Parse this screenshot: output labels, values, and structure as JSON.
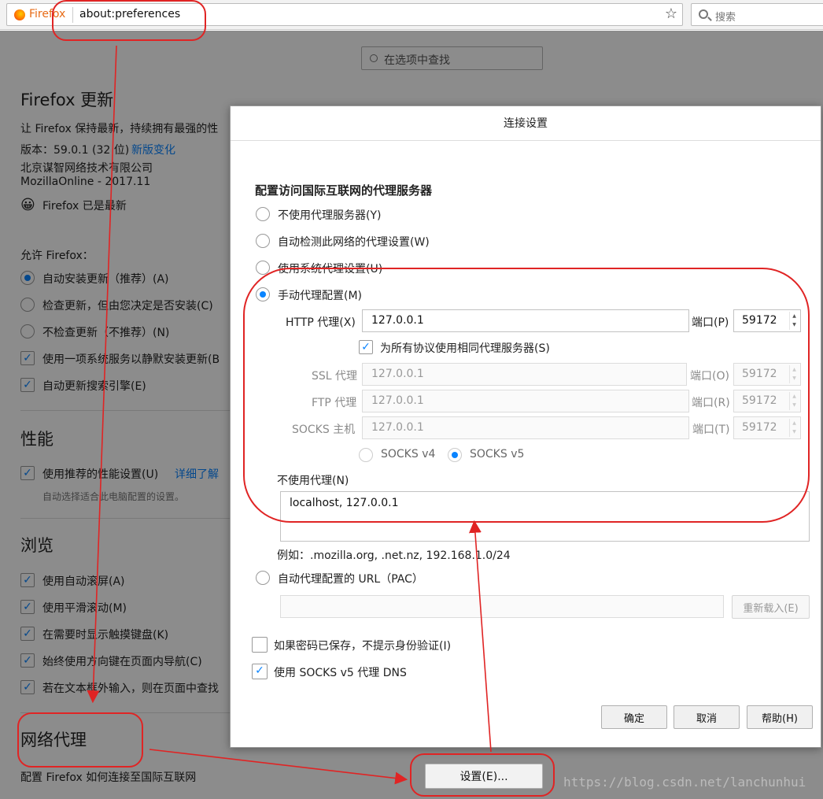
{
  "browser": {
    "brand": "Firefox",
    "url": "about:preferences",
    "search_placeholder": "搜索"
  },
  "prefs": {
    "search_placeholder": "在选项中查找",
    "update": {
      "title": "Firefox 更新",
      "desc": "让 Firefox 保持最新，持续拥有最强的性",
      "version": "版本：59.0.1 (32 位)",
      "changes_link": "新版变化",
      "company": "北京谋智网络技术有限公司",
      "build": "MozillaOnline - 2017.11",
      "status": "Firefox 已是最新",
      "allow_label": "允许 Firefox：",
      "opt_auto": "自动安装更新（推荐）(A)",
      "opt_check": "检查更新，但由您决定是否安装(C)",
      "opt_never": "不检查更新（不推荐）(N)",
      "opt_service": "使用一项系统服务以静默安装更新(B",
      "opt_engines": "自动更新搜索引擎(E)"
    },
    "perf": {
      "title": "性能",
      "recommended": "使用推荐的性能设置(U)",
      "learn_more": "详细了解",
      "hint": "自动选择适合此电脑配置的设置。"
    },
    "browsing": {
      "title": "浏览",
      "autoscroll": "使用自动滚屏(A)",
      "smooth": "使用平滑滚动(M)",
      "touch_kb": "在需要时显示触摸键盘(K)",
      "cursor_keys": "始终使用方向键在页面内导航(C)",
      "find_typing": "若在文本框外输入，则在页面中查找"
    },
    "network": {
      "title": "网络代理",
      "desc": "配置 Firefox 如何连接至国际互联网",
      "settings_button": "设置(E)..."
    }
  },
  "dialog": {
    "title": "连接设置",
    "heading": "配置访问国际互联网的代理服务器",
    "no_proxy": "不使用代理服务器(Y)",
    "auto_detect": "自动检测此网络的代理设置(W)",
    "system_proxy": "使用系统代理设置(U)",
    "manual": "手动代理配置(M)",
    "http_label": "HTTP 代理(X)",
    "http_value": "127.0.0.1",
    "port_p": "端口(P)",
    "http_port": "59172",
    "same_proxy": "为所有协议使用相同代理服务器(S)",
    "ssl_label": "SSL 代理",
    "ssl_value": "127.0.0.1",
    "port_o": "端口(O)",
    "ssl_port": "59172",
    "ftp_label": "FTP 代理",
    "ftp_value": "127.0.0.1",
    "port_r": "端口(R)",
    "ftp_port": "59172",
    "socks_label": "SOCKS 主机",
    "socks_value": "127.0.0.1",
    "port_t": "端口(T)",
    "socks_port": "59172",
    "socks4": "SOCKS v4",
    "socks5": "SOCKS v5",
    "no_proxy_for": "不使用代理(N)",
    "no_proxy_value": "localhost, 127.0.0.1",
    "example": "例如：.mozilla.org, .net.nz, 192.168.1.0/24",
    "pac_label": "自动代理配置的 URL（PAC）",
    "pac_value": "",
    "reload": "重新载入(E)",
    "no_auth_prompt": "如果密码已保存，不提示身份验证(I)",
    "socks_dns": "使用 SOCKS v5 代理 DNS",
    "ok": "确定",
    "cancel": "取消",
    "help": "帮助(H)"
  },
  "annotation_color": "#e02424",
  "watermark": "https://blog.csdn.net/lanchunhui"
}
